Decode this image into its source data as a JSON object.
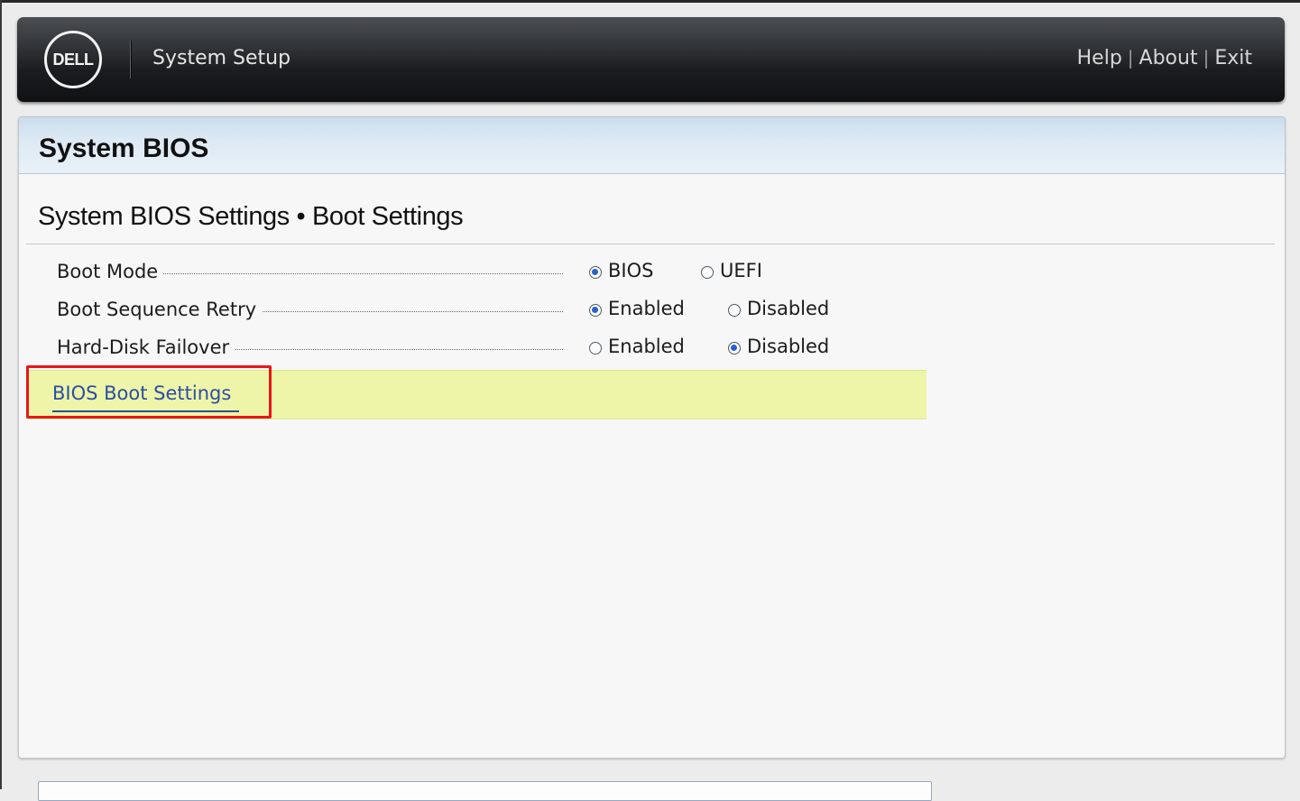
{
  "header": {
    "logo_text": "DELL",
    "title": "System Setup",
    "links": [
      "Help",
      "About",
      "Exit"
    ],
    "separator": "|"
  },
  "panel": {
    "title": "System BIOS",
    "section_title": "System BIOS Settings • Boot Settings"
  },
  "settings": [
    {
      "label": "Boot Mode",
      "options": [
        {
          "label": "BIOS",
          "selected": true
        },
        {
          "label": "UEFI",
          "selected": false
        }
      ]
    },
    {
      "label": "Boot Sequence Retry",
      "options": [
        {
          "label": "Enabled",
          "selected": true
        },
        {
          "label": "Disabled",
          "selected": false
        }
      ]
    },
    {
      "label": "Hard-Disk Failover",
      "options": [
        {
          "label": "Enabled",
          "selected": false
        },
        {
          "label": "Disabled",
          "selected": true
        }
      ]
    }
  ],
  "submenu": {
    "label": "BIOS Boot Settings"
  },
  "colors": {
    "selected_radio": "#2a5fd0",
    "highlight_row": "#eef5a8",
    "link": "#2b4fa3",
    "annotation_box": "#e8161b"
  }
}
